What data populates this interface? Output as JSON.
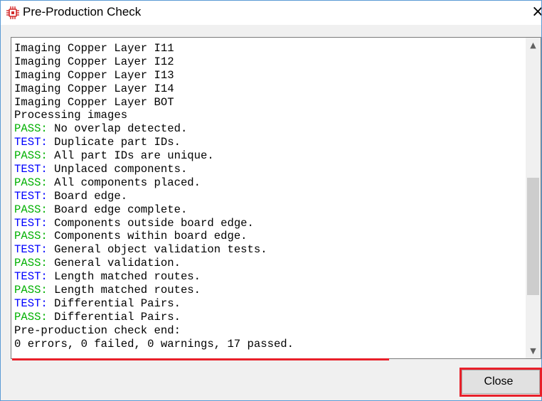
{
  "window": {
    "title": "Pre-Production Check",
    "close_glyph": "×",
    "icon": "chip-icon"
  },
  "log": {
    "lines": [
      {
        "prefix": "",
        "text": "Imaging Copper Layer I11"
      },
      {
        "prefix": "",
        "text": "Imaging Copper Layer I12"
      },
      {
        "prefix": "",
        "text": "Imaging Copper Layer I13"
      },
      {
        "prefix": "",
        "text": "Imaging Copper Layer I14"
      },
      {
        "prefix": "",
        "text": "Imaging Copper Layer BOT"
      },
      {
        "prefix": "",
        "text": "Processing images"
      },
      {
        "prefix": "PASS:",
        "text": " No overlap detected."
      },
      {
        "prefix": "TEST:",
        "text": " Duplicate part IDs."
      },
      {
        "prefix": "PASS:",
        "text": " All part IDs are unique."
      },
      {
        "prefix": "TEST:",
        "text": " Unplaced components."
      },
      {
        "prefix": "PASS:",
        "text": " All components placed."
      },
      {
        "prefix": "TEST:",
        "text": " Board edge."
      },
      {
        "prefix": "PASS:",
        "text": " Board edge complete."
      },
      {
        "prefix": "TEST:",
        "text": " Components outside board edge."
      },
      {
        "prefix": "PASS:",
        "text": " Components within board edge."
      },
      {
        "prefix": "TEST:",
        "text": " General object validation tests."
      },
      {
        "prefix": "PASS:",
        "text": " General validation."
      },
      {
        "prefix": "TEST:",
        "text": " Length matched routes."
      },
      {
        "prefix": "PASS:",
        "text": " Length matched routes."
      },
      {
        "prefix": "TEST:",
        "text": " Differential Pairs."
      },
      {
        "prefix": "PASS:",
        "text": " Differential Pairs."
      },
      {
        "prefix": "",
        "text": "Pre-production check end:"
      },
      {
        "prefix": "",
        "text": "0 errors, 0 failed, 0 warnings, 17 passed."
      }
    ],
    "scroll_position": 0.72
  },
  "footer": {
    "close_label": "Close"
  },
  "colors": {
    "test_prefix": "#0000ff",
    "pass_prefix": "#00b000",
    "highlight": "#e8202a"
  }
}
